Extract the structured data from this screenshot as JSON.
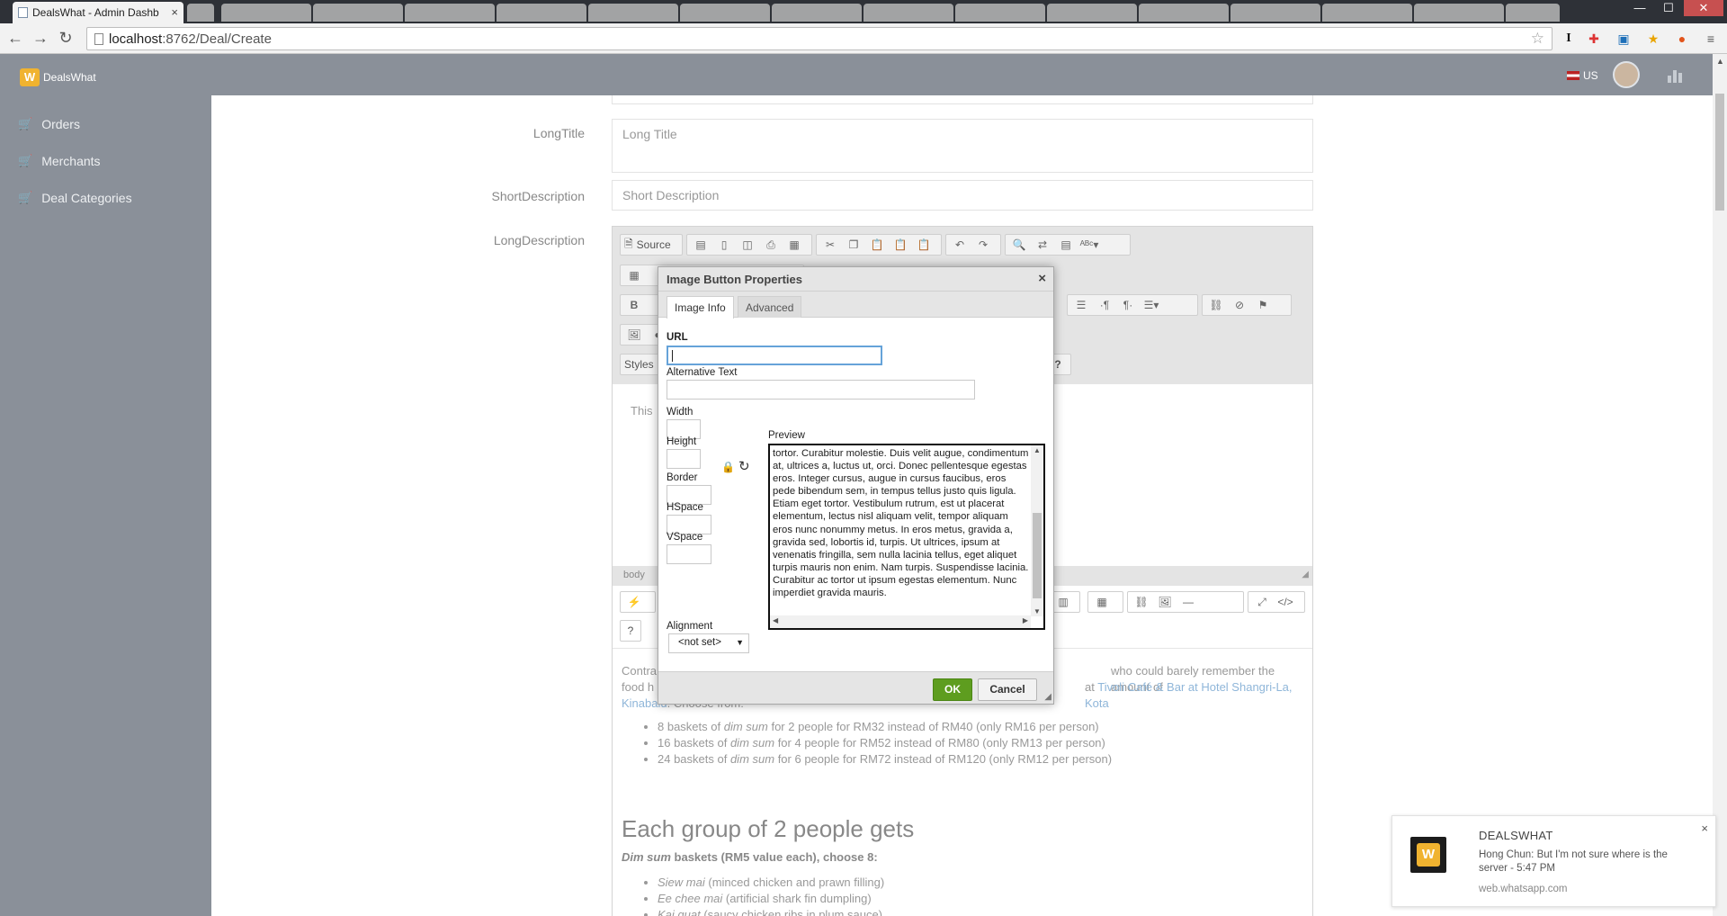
{
  "browser": {
    "tab_title": "DealsWhat - Admin Dashb",
    "tab_close": "×",
    "url_host": "localhost",
    "url_path": ":8762/Deal/Create",
    "back": "←",
    "forward": "→",
    "reload": "↻",
    "star": "☆",
    "window_min": "—",
    "window_max": "☐",
    "window_close": "✕"
  },
  "app": {
    "brand": "DealsWhat",
    "logo_letter": "W",
    "language": "US"
  },
  "sidebar": {
    "items": [
      {
        "label": "Orders"
      },
      {
        "label": "Merchants"
      },
      {
        "label": "Deal Categories"
      }
    ]
  },
  "form": {
    "long_title_label": "LongTitle",
    "long_title_placeholder": "Long Title",
    "short_description_label": "ShortDescription",
    "short_description_placeholder": "Short Description",
    "long_description_label": "LongDescription"
  },
  "editor": {
    "source_label": "Source",
    "styles_label": "Styles",
    "help_label": "?",
    "content_start": "This",
    "status_path": "body",
    "bold": "B"
  },
  "content": {
    "intro_start": "Contra",
    "intro_mid": "who could barely remember the amount of",
    "intro_line2_start": "food h",
    "intro_line2_end": "at",
    "venue_link": "Tivoli Café & Bar at Hotel Shangri-La, Kota",
    "venue_link_2": "Kinabalu",
    "choose_from": ". Choose from:",
    "deals": [
      {
        "pre": "8 baskets of ",
        "em": "dim sum",
        "post": " for 2 people for RM32 instead of RM40 (only RM16 per person)"
      },
      {
        "pre": "16 baskets of ",
        "em": "dim sum",
        "post": " for 4 people for RM52 instead of RM80 (only RM13 per person)"
      },
      {
        "pre": "24 baskets of ",
        "em": "dim sum",
        "post": " for 6 people for RM72 instead of RM120 (only RM12 per person)"
      }
    ],
    "heading": "Each group of 2 people gets",
    "subheading_em": "Dim sum",
    "subheading_rest": " baskets (RM5 value each), choose 8:",
    "items": [
      {
        "em": "Siew mai",
        "post": " (minced chicken and prawn filling)"
      },
      {
        "em": "Ee chee mai",
        "post": " (artificial shark fin dumpling)"
      },
      {
        "em": "Kai quat",
        "post": " (saucy chicken ribs in plum sauce)"
      }
    ]
  },
  "dialog": {
    "title": "Image Button Properties",
    "close": "×",
    "tabs": [
      {
        "label": "Image Info",
        "active": true
      },
      {
        "label": "Advanced",
        "active": false
      }
    ],
    "url_label": "URL",
    "url_value": "",
    "alt_label": "Alternative Text",
    "alt_value": "",
    "width_label": "Width",
    "height_label": "Height",
    "border_label": "Border",
    "hspace_label": "HSpace",
    "vspace_label": "VSpace",
    "alignment_label": "Alignment",
    "alignment_value": "<not set>",
    "preview_label": "Preview",
    "preview_text": "tortor. Curabitur molestie. Duis velit augue, condimentum at, ultrices a, luctus ut, orci. Donec pellentesque egestas eros. Integer cursus, augue in cursus faucibus, eros pede bibendum sem, in tempus tellus justo quis ligula. Etiam eget tortor. Vestibulum rutrum, est ut placerat elementum, lectus nisl aliquam velit, tempor aliquam eros nunc nonummy metus. In eros metus, gravida a, gravida sed, lobortis id, turpis. Ut ultrices, ipsum at venenatis fringilla, sem nulla lacinia tellus, eget aliquet turpis mauris non enim. Nam turpis. Suspendisse lacinia. Curabitur ac tortor ut ipsum egestas elementum. Nunc imperdiet gravida mauris.",
    "ok_label": "OK",
    "cancel_label": "Cancel"
  },
  "notification": {
    "title": "DEALSWHAT",
    "body": "Hong Chun: But I'm not sure where is the server - 5:47 PM",
    "source": "web.whatsapp.com",
    "close": "×",
    "logo_letter": "W"
  },
  "colors": {
    "header_bg": "#8a9099",
    "ok_green": "#5e9d1f",
    "link_blue": "#8fb6d9",
    "brand_orange": "#f0b330"
  }
}
